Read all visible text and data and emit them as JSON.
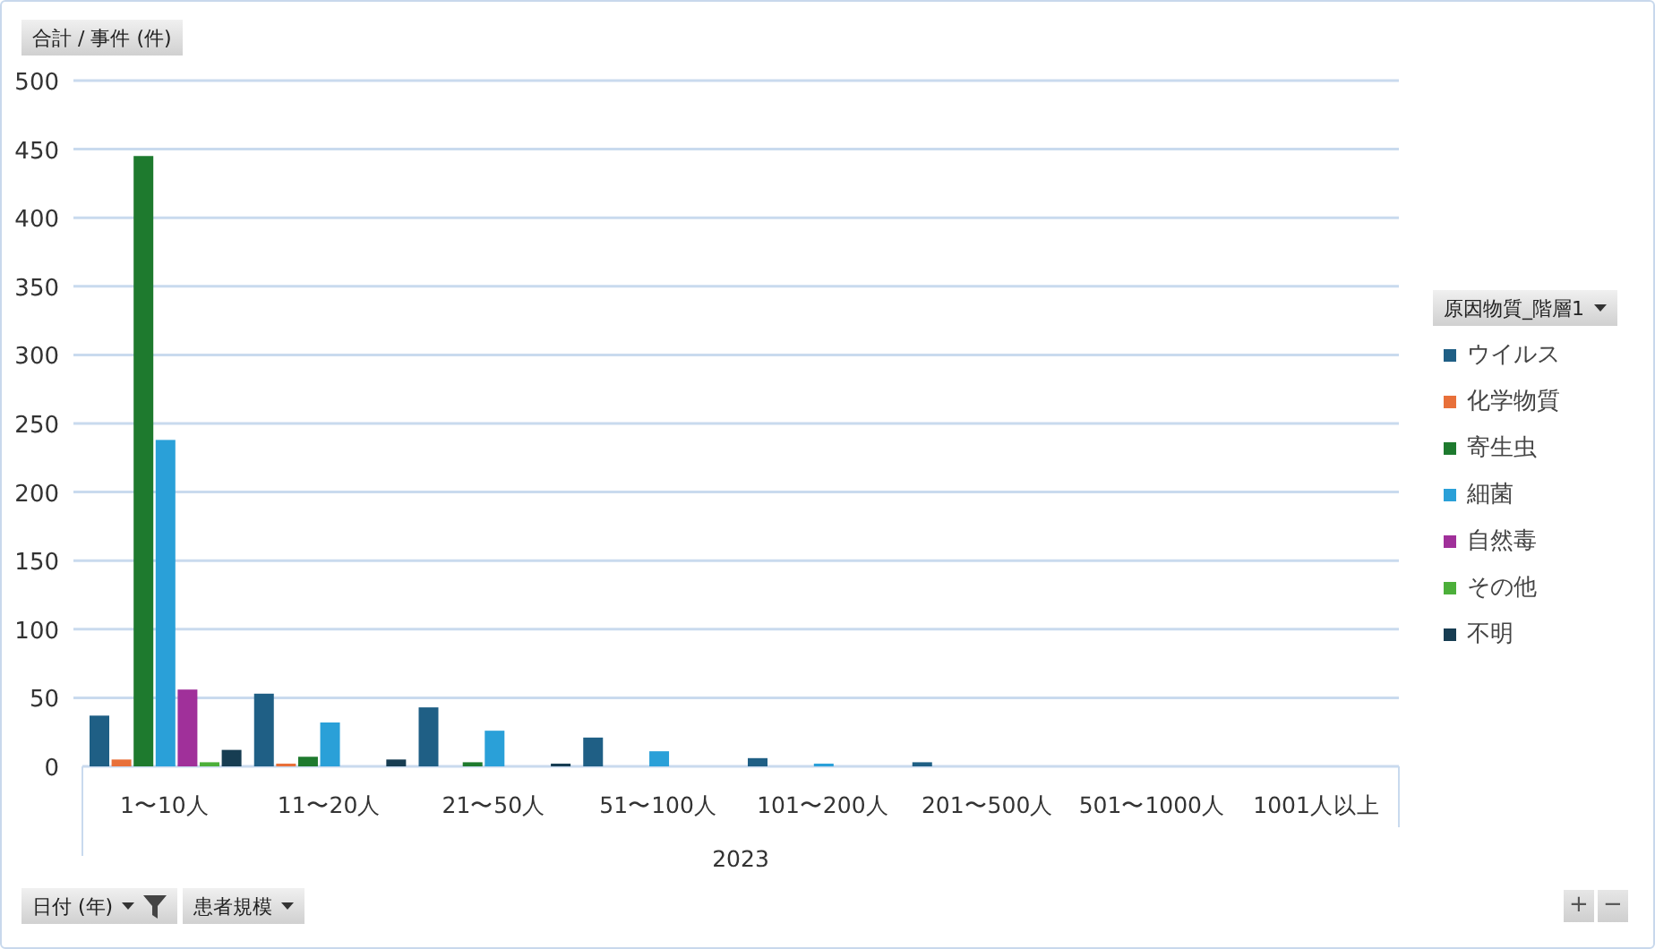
{
  "value_field_button": {
    "label": "合計 / 事件 (件)"
  },
  "chart": {
    "chart_data": {
      "type": "bar",
      "grid": true,
      "xlabel": "2023",
      "categories": [
        "1〜10人",
        "11〜20人",
        "21〜50人",
        "51〜100人",
        "101〜200人",
        "201〜500人",
        "501〜1000人",
        "1001人以上"
      ],
      "ylim": [
        0,
        500
      ],
      "yticks": [
        0,
        50,
        100,
        150,
        200,
        250,
        300,
        350,
        400,
        450,
        500
      ],
      "series": [
        {
          "name": "ウイルス",
          "color": "#1f5f85",
          "values": [
            37,
            53,
            43,
            21,
            6,
            3,
            null,
            null
          ]
        },
        {
          "name": "化学物質",
          "color": "#e8703a",
          "values": [
            5,
            2,
            null,
            null,
            null,
            null,
            null,
            null
          ]
        },
        {
          "name": "寄生虫",
          "color": "#1e7a2e",
          "values": [
            445,
            7,
            3,
            null,
            null,
            null,
            null,
            null
          ]
        },
        {
          "name": "細菌",
          "color": "#2aa0d8",
          "values": [
            238,
            32,
            26,
            11,
            2,
            null,
            null,
            null
          ]
        },
        {
          "name": "自然毒",
          "color": "#a0309a",
          "values": [
            56,
            null,
            null,
            null,
            null,
            null,
            null,
            null
          ]
        },
        {
          "name": "その他",
          "color": "#4caf3a",
          "values": [
            3,
            null,
            null,
            null,
            null,
            null,
            null,
            null
          ]
        },
        {
          "name": "不明",
          "color": "#173d52",
          "values": [
            12,
            5,
            2,
            null,
            null,
            null,
            null,
            null
          ]
        }
      ]
    }
  },
  "legend": {
    "field_button": "原因物質_階層1"
  },
  "axis_field_buttons": [
    {
      "label": "日付 (年)",
      "filtered": true
    },
    {
      "label": "患者規模",
      "filtered": false
    }
  ],
  "zoom_buttons": [
    "+",
    "−"
  ]
}
